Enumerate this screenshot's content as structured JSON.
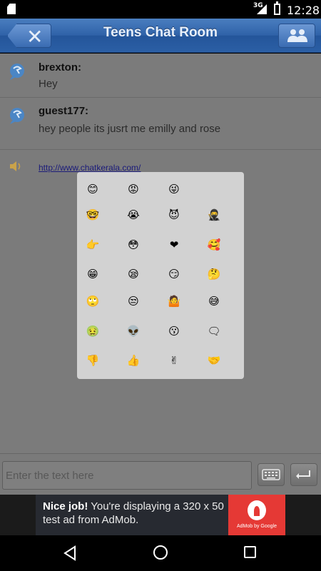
{
  "status": {
    "network": "3G",
    "time": "12:28"
  },
  "header": {
    "title": "Teens Chat Room"
  },
  "messages": [
    {
      "user": "brexton:",
      "text": "Hey"
    },
    {
      "user": "guest177:",
      "text": "hey people its jusrt me emilly and rose"
    }
  ],
  "link_message": {
    "url": "http://www.chatkerala.com/"
  },
  "emojis": [
    [
      "smile-emoji",
      "😊"
    ],
    [
      "angry-emoji",
      "😡"
    ],
    [
      "wink-emoji",
      "😜"
    ],
    [
      "nerd-emoji",
      "🤓"
    ],
    [
      "crying-emoji",
      "😭"
    ],
    [
      "devil-emoji",
      "😈"
    ],
    [
      "ninja-emoji",
      "🥷"
    ],
    [
      "pointing-emoji",
      "👉"
    ],
    [
      "blush-emoji",
      "😳"
    ],
    [
      "heart-emoji",
      "❤"
    ],
    [
      "couple-emoji",
      "🥰"
    ],
    [
      "grin-emoji",
      "😁"
    ],
    [
      "sleepy-emoji",
      "😪"
    ],
    [
      "smirk-emoji",
      "😏"
    ],
    [
      "thinking-emoji",
      "🤔"
    ],
    [
      "eye-roll-emoji",
      "🙄"
    ],
    [
      "unamused-emoji",
      "😒"
    ],
    [
      "shrug-emoji",
      "🤷"
    ],
    [
      "sweat-emoji",
      "😅"
    ],
    [
      "sick-emoji",
      "🤢"
    ],
    [
      "alien-emoji",
      "👽"
    ],
    [
      "whistle-emoji",
      "😗"
    ],
    [
      "talking-emoji",
      "🗨"
    ],
    [
      "thumbs-down-emoji",
      "👎"
    ],
    [
      "thumbs-up-emoji",
      "👍"
    ],
    [
      "peace-emoji",
      "✌"
    ],
    [
      "handshake-emoji",
      "🤝"
    ]
  ],
  "input": {
    "placeholder": "Enter the text here"
  },
  "ad": {
    "headline_bold": "Nice job!",
    "headline_rest": " You're displaying a 320 x 50 test ad from AdMob.",
    "brand": "AdMob by Google"
  },
  "colors": {
    "appbar": "#2f62a8",
    "chat_bg": "#7b7b7b",
    "panel_bg": "#d2d2d2",
    "ad_logo": "#e53935"
  }
}
